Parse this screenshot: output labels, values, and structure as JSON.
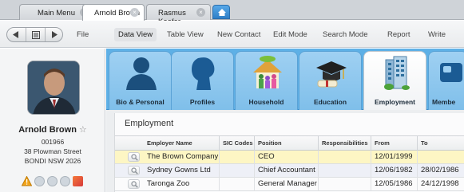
{
  "tabs": [
    {
      "label": "Main Menu",
      "active": false
    },
    {
      "label": "Arnold Brown",
      "active": true
    },
    {
      "label": "Rasmus Keefer",
      "active": false
    }
  ],
  "toolbar": {
    "file": "File",
    "data_view": "Data View",
    "table_view": "Table View",
    "new_contact": "New Contact",
    "edit_mode": "Edit Mode",
    "search_mode": "Search Mode",
    "report": "Report",
    "write": "Write"
  },
  "profile": {
    "name": "Arnold Brown",
    "star": "☆",
    "id": "001966",
    "street": "38 Plowman Street",
    "city": "BONDI NSW 2026"
  },
  "categories": [
    {
      "label": "Bio & Personal",
      "icon": "bio-icon"
    },
    {
      "label": "Profiles",
      "icon": "profiles-icon"
    },
    {
      "label": "Household",
      "icon": "household-icon"
    },
    {
      "label": "Education",
      "icon": "education-icon"
    },
    {
      "label": "Employment",
      "icon": "employment-icon"
    },
    {
      "label": "Membe",
      "icon": "membership-icon"
    }
  ],
  "employment": {
    "title": "Employment",
    "columns": [
      "Employer Name",
      "SIC Codes",
      "Position",
      "Responsibilities",
      "From",
      "To"
    ],
    "rows": [
      {
        "employer": "The Brown Company",
        "sic": "",
        "position": "CEO",
        "responsibilities": "",
        "from": "12/01/1999",
        "to": ""
      },
      {
        "employer": "Sydney Gowns Ltd",
        "sic": "",
        "position": "Chief Accountant",
        "responsibilities": "",
        "from": "12/06/1982",
        "to": "28/02/1986"
      },
      {
        "employer": "Taronga Zoo",
        "sic": "",
        "position": "General Manager",
        "responsibilities": "",
        "from": "12/05/1986",
        "to": "24/12/1998"
      }
    ]
  },
  "colors": {
    "category_bar": "#5eb0e6",
    "selected_row": "#fdf6c4"
  }
}
